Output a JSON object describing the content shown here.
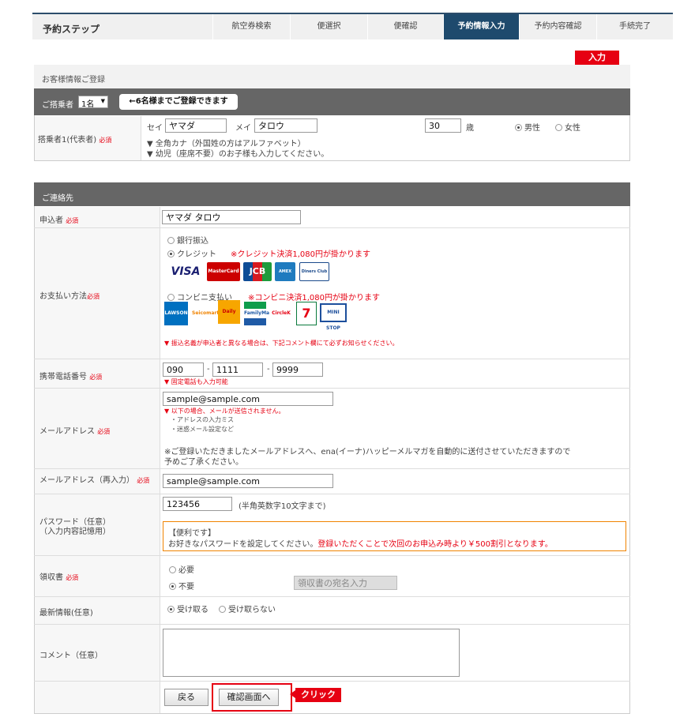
{
  "steps": {
    "title": "予約ステップ",
    "items": [
      "航空券検索",
      "便選択",
      "便確認",
      "予約情報入力",
      "予約内容確認",
      "手続完了"
    ],
    "active_index": 3
  },
  "callouts": {
    "input": "入力",
    "click": "クリック"
  },
  "customer": {
    "section_title": "お客様情報ご登録",
    "passengers_label": "ご搭乗者",
    "passengers_count": "1名",
    "passengers_note": "←6名様までご登録できます",
    "passenger1_label": "搭乗者1(代表者)",
    "required": "必須",
    "sei_label": "セイ",
    "sei_value": "ヤマダ",
    "mei_label": "メイ",
    "mei_value": "タロウ",
    "age_value": "30",
    "age_unit": "歳",
    "gender_male": "男性",
    "gender_female": "女性",
    "note1": "▼ 全角カナ（外国姓の方はアルファベット）",
    "note2": "▼ 幼児（座席不要）のお子様も入力してください。"
  },
  "contact": {
    "section_title": "ご連絡先",
    "applicant_label": "申込者",
    "applicant_value": "ヤマダ タロウ",
    "payment_label": "お支払い方法",
    "pay_bank": "銀行振込",
    "pay_credit": "クレジット",
    "pay_credit_note": "※クレジット決済1,080円が掛かります",
    "pay_conv": "コンビニ支払い",
    "pay_conv_note": "※コンビニ決済1,080円が掛かります",
    "pay_footnote": "▼ 振込名義が申込者と異なる場合は、下記コメント欄にて必ずお知らせください。",
    "cards": [
      "VISA",
      "MasterCard",
      "JCB",
      "AMEX",
      "Diners Club"
    ],
    "stores": [
      "LAWSON",
      "Seicomart",
      "Daily",
      "FamilyMart",
      "CircleK",
      "7",
      "MINI STOP"
    ],
    "phone_label": "携帯電話番号",
    "phone1": "090",
    "phone2": "1111",
    "phone3": "9999",
    "phone_sep": "-",
    "phone_note": "▼ 固定電話も入力可能",
    "email_label": "メールアドレス",
    "email_value": "sample@sample.com",
    "email_note1": "▼ 以下の場合、メールが送信されません。",
    "email_note2": "・アドレスの入力ミス",
    "email_note3": "・迷惑メール設定など",
    "email_notice": "※ご登録いただきましたメールアドレスへ、ena(イーナ)ハッピーメルマガを自動的に送付させていただきますので",
    "email_notice2": "予めご了承ください。",
    "email2_label": "メールアドレス（再入力）",
    "email2_value": "sample@sample.com",
    "password_label": "パスワード（任意）",
    "password_sub": "（入力内容記憶用）",
    "password_value": "123456",
    "password_hint": "(半角英数字10文字まで)",
    "password_tip_title": "【便利です】",
    "password_tip_text": "お好きなパスワードを設定してください。",
    "password_tip_red": "登録いただくことで次回のお申込み時より￥500割引となります。",
    "receipt_label": "領収書",
    "receipt_yes": "必要",
    "receipt_no": "不要",
    "receipt_placeholder": "領収書の宛名入力",
    "news_label": "最新情報(任意)",
    "news_yes": "受け取る",
    "news_no": "受け取らない",
    "comment_label": "コメント（任意）",
    "back_button": "戻る",
    "confirm_button": "確認画面へ"
  }
}
